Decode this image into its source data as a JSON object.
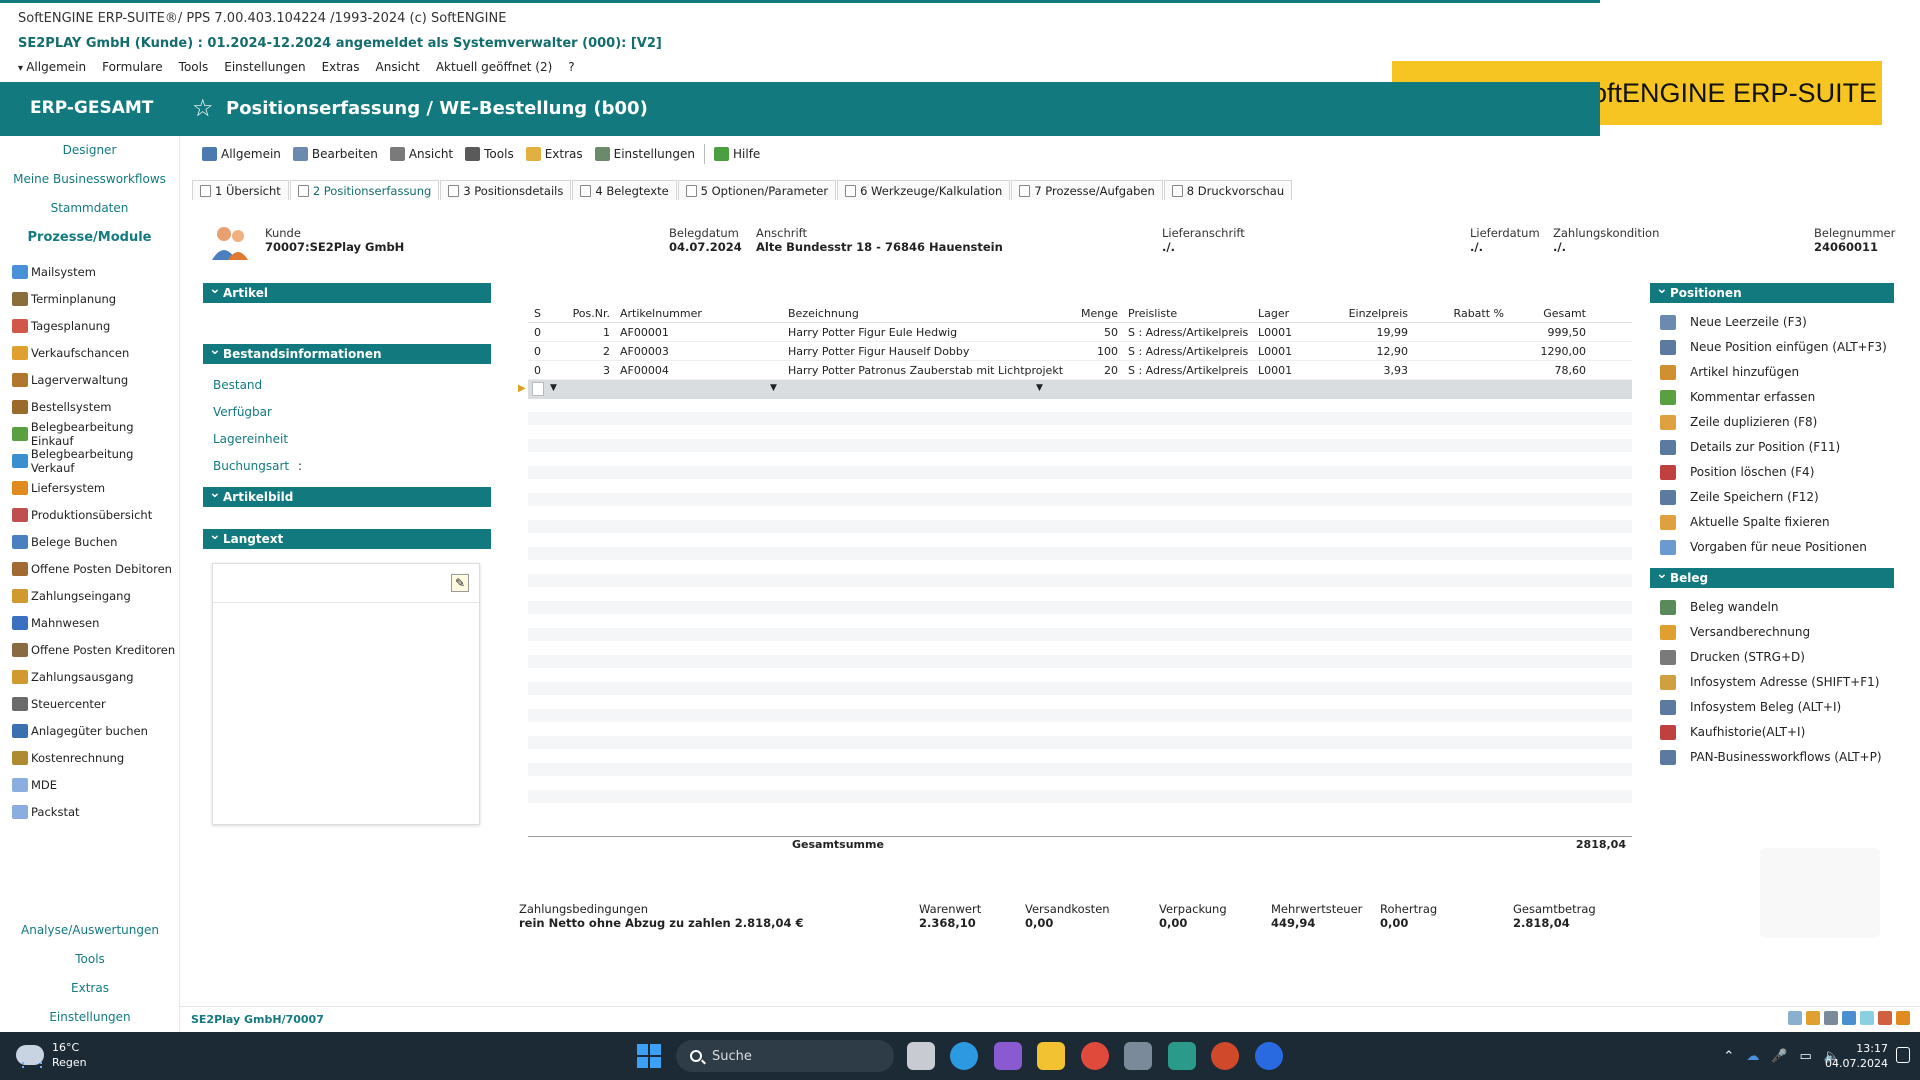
{
  "window": {
    "title_line": "SoftENGINE ERP-SUITE®/ PPS 7.00.403.104224 /1993-2024 (c) SoftENGINE",
    "login_line": "SE2PLAY GmbH (Kunde) : 01.2024-12.2024 angemeldet als Systemverwalter (000): [V2]"
  },
  "menubar": [
    "Allgemein",
    "Formulare",
    "Tools",
    "Einstellungen",
    "Extras",
    "Ansicht",
    "Aktuell geöffnet (2)",
    "?"
  ],
  "banner": "Beispiel in der SoftENGINE ERP-SUITE",
  "header": {
    "app_name": "ERP-GESAMT",
    "page_title": "Positionserfassung / WE-Bestellung (b00)"
  },
  "sidebar": {
    "top": [
      "Designer",
      "Meine Businessworkflows",
      "Stammdaten",
      "Prozesse/Module"
    ],
    "modules": [
      {
        "label": "Mailsystem",
        "icon": "mail-icon",
        "color": "#4a90d9"
      },
      {
        "label": "Terminplanung",
        "icon": "people-icon",
        "color": "#8a6d3b"
      },
      {
        "label": "Tagesplanung",
        "icon": "calendar-icon",
        "color": "#d0574a"
      },
      {
        "label": "Verkaufschancen",
        "icon": "money-icon",
        "color": "#e0a030"
      },
      {
        "label": "Lagerverwaltung",
        "icon": "warehouse-icon",
        "color": "#b0782e"
      },
      {
        "label": "Bestellsystem",
        "icon": "order-icon",
        "color": "#9a6a2a"
      },
      {
        "label": "Belegbearbeitung Einkauf",
        "icon": "purchase-icon",
        "color": "#5aa040"
      },
      {
        "label": "Belegbearbeitung Verkauf",
        "icon": "sales-icon",
        "color": "#3a8fd0"
      },
      {
        "label": "Liefersystem",
        "icon": "delivery-icon",
        "color": "#e08a20"
      },
      {
        "label": "Produktionsübersicht",
        "icon": "production-icon",
        "color": "#c05050"
      },
      {
        "label": "Belege Buchen",
        "icon": "booking-icon",
        "color": "#4a80c0"
      },
      {
        "label": "Offene Posten Debitoren",
        "icon": "debtors-icon",
        "color": "#a06a30"
      },
      {
        "label": "Zahlungseingang",
        "icon": "payment-in-icon",
        "color": "#d09a30"
      },
      {
        "label": "Mahnwesen",
        "icon": "reminder-icon",
        "color": "#3a70c0"
      },
      {
        "label": "Offene Posten Kreditoren",
        "icon": "creditors-icon",
        "color": "#8a6a40"
      },
      {
        "label": "Zahlungsausgang",
        "icon": "payment-out-icon",
        "color": "#d09a30"
      },
      {
        "label": "Steuercenter",
        "icon": "tax-icon",
        "color": "#6a6a6a"
      },
      {
        "label": "Anlagegüter buchen",
        "icon": "assets-icon",
        "color": "#3a70b0"
      },
      {
        "label": "Kostenrechnung",
        "icon": "cost-icon",
        "color": "#b08a30"
      },
      {
        "label": "MDE",
        "icon": "mde-icon",
        "color": "#8aaee0"
      },
      {
        "label": "Packstat",
        "icon": "packstat-icon",
        "color": "#8aaee0"
      }
    ],
    "bottom": [
      "Analyse/Auswertungen",
      "Tools",
      "Extras",
      "Einstellungen"
    ]
  },
  "toolbar": [
    {
      "label": "Allgemein",
      "icon": "home-icon",
      "color": "#4a7ab0"
    },
    {
      "label": "Bearbeiten",
      "icon": "edit-icon",
      "color": "#6a8ab0"
    },
    {
      "label": "Ansicht",
      "icon": "view-icon",
      "color": "#7a7a7a"
    },
    {
      "label": "Tools",
      "icon": "tools-icon",
      "color": "#5a5a5a"
    },
    {
      "label": "Extras",
      "icon": "folder-icon",
      "color": "#e0b040"
    },
    {
      "label": "Einstellungen",
      "icon": "settings-icon",
      "color": "#6a8a6a"
    },
    {
      "label": "Hilfe",
      "icon": "help-icon",
      "color": "#4aa040"
    }
  ],
  "tabs": [
    {
      "label": "1 Übersicht",
      "active": false
    },
    {
      "label": "2 Positionserfassung",
      "active": true
    },
    {
      "label": "3 Positionsdetails",
      "active": false
    },
    {
      "label": "4 Belegtexte",
      "active": false
    },
    {
      "label": "5 Optionen/Parameter",
      "active": false
    },
    {
      "label": "6 Werkzeuge/Kalkulation",
      "active": false
    },
    {
      "label": "7 Prozesse/Aufgaben",
      "active": false
    },
    {
      "label": "8 Druckvorschau",
      "active": false
    }
  ],
  "info": {
    "kunde_label": "Kunde",
    "kunde_value": "70007:SE2Play GmbH",
    "belegdatum_label": "Belegdatum",
    "belegdatum_value": "04.07.2024",
    "anschrift_label": "Anschrift",
    "anschrift_value": "Alte Bundesstr 18 - 76846 Hauenstein",
    "lieferanschrift_label": "Lieferanschrift",
    "lieferanschrift_value": "./.",
    "lieferdatum_label": "Lieferdatum",
    "lieferdatum_value": "./.",
    "zahlungskondition_label": "Zahlungskondition",
    "zahlungskondition_value": "./.",
    "belegnummer_label": "Belegnummer",
    "belegnummer_value": "24060011"
  },
  "left_panels": {
    "artikel": "Artikel",
    "bestand_header": "Bestandsinformationen",
    "bestand_items": [
      "Bestand",
      "Verfügbar",
      "Lagereinheit",
      "Buchungsart"
    ],
    "buchungsart_value": ":",
    "artikelbild": "Artikelbild",
    "langtext": "Langtext"
  },
  "grid": {
    "headers": {
      "s": "S",
      "pos": "Pos.Nr.",
      "art": "Artikelnummer",
      "bez": "Bezeichnung",
      "menge": "Menge",
      "pl": "Preisliste",
      "lager": "Lager",
      "ep": "Einzelpreis",
      "rab": "Rabatt %",
      "ges": "Gesamt"
    },
    "rows": [
      {
        "s": "0",
        "pos": "1",
        "art": "AF00001",
        "bez": "Harry Potter Figur Eule Hedwig",
        "menge": "50",
        "pl": "S    : Adress/Artikelpreis",
        "lager": "L0001",
        "ep": "19,99",
        "rab": "",
        "ges": "999,50"
      },
      {
        "s": "0",
        "pos": "2",
        "art": "AF00003",
        "bez": "Harry Potter Figur Hauself Dobby",
        "menge": "100",
        "pl": "S    : Adress/Artikelpreis",
        "lager": "L0001",
        "ep": "12,90",
        "rab": "",
        "ges": "1290,00"
      },
      {
        "s": "0",
        "pos": "3",
        "art": "AF00004",
        "bez": "Harry Potter Patronus Zauberstab mit Lichtprojekt",
        "menge": "20",
        "pl": "S    : Adress/Artikelpreis",
        "lager": "L0001",
        "ep": "3,93",
        "rab": "",
        "ges": "78,60"
      }
    ],
    "sum_label": "Gesamtsumme",
    "sum_value": "2818,04"
  },
  "footer_summary": {
    "zb_label": "Zahlungsbedingungen",
    "zb_value": "rein Netto ohne Abzug zu zahlen 2.818,04 €",
    "warenwert_label": "Warenwert",
    "warenwert_value": "2.368,10",
    "versand_label": "Versandkosten",
    "versand_value": "0,00",
    "verpackung_label": "Verpackung",
    "verpackung_value": "0,00",
    "mwst_label": "Mehrwertsteuer",
    "mwst_value": "449,94",
    "rohertrag_label": "Rohertrag",
    "rohertrag_value": "0,00",
    "gesamt_label": "Gesamtbetrag",
    "gesamt_value": "2.818,04"
  },
  "right_panel": {
    "positionen": "Positionen",
    "positionen_items": [
      {
        "label": "Neue Leerzeile (F3)",
        "icon": "new-line-icon",
        "color": "#6a8ab0"
      },
      {
        "label": "Neue Position einfügen (ALT+F3)",
        "icon": "insert-icon",
        "color": "#5a7aa0"
      },
      {
        "label": "Artikel hinzufügen",
        "icon": "article-add-icon",
        "color": "#d09030"
      },
      {
        "label": "Kommentar erfassen",
        "icon": "comment-icon",
        "color": "#5aa040"
      },
      {
        "label": "Zeile duplizieren (F8)",
        "icon": "duplicate-icon",
        "color": "#e0a040"
      },
      {
        "label": "Details zur Position (F11)",
        "icon": "details-icon",
        "color": "#5a7aa0"
      },
      {
        "label": "Position löschen (F4)",
        "icon": "delete-icon",
        "color": "#c04040"
      },
      {
        "label": "Zeile Speichern (F12)",
        "icon": "save-icon",
        "color": "#5a7aa0"
      },
      {
        "label": "Aktuelle Spalte fixieren",
        "icon": "pin-column-icon",
        "color": "#e0a040"
      },
      {
        "label": "Vorgaben für neue Positionen",
        "icon": "defaults-icon",
        "color": "#6a9ad0"
      }
    ],
    "beleg": "Beleg",
    "beleg_items": [
      {
        "label": "Beleg wandeln",
        "icon": "convert-icon",
        "color": "#5a8a5a"
      },
      {
        "label": "Versandberechnung",
        "icon": "shipping-icon",
        "color": "#e0a030"
      },
      {
        "label": "Drucken (STRG+D)",
        "icon": "print-icon",
        "color": "#7a7a7a"
      },
      {
        "label": "Infosystem Adresse (SHIFT+F1)",
        "icon": "info-address-icon",
        "color": "#d0a040"
      },
      {
        "label": "Infosystem Beleg (ALT+I)",
        "icon": "info-document-icon",
        "color": "#5a7aa0"
      },
      {
        "label": "Kaufhistorie(ALT+I)",
        "icon": "history-icon",
        "color": "#c04040"
      },
      {
        "label": "PAN-Businessworkflows (ALT+P)",
        "icon": "workflow-icon",
        "color": "#5a7aa0"
      }
    ]
  },
  "statusbar": {
    "left": "SE2Play GmbH/70007"
  },
  "taskbar": {
    "temp": "16°C",
    "weather": "Regen",
    "search": "Suche",
    "time": "13:17",
    "date": "04.07.2024"
  }
}
